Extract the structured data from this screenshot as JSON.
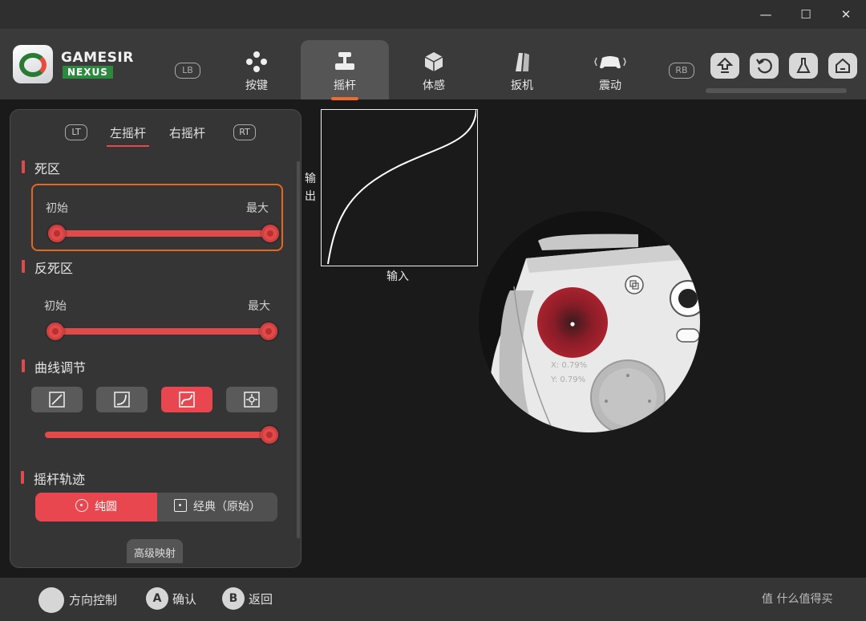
{
  "window": {
    "min": "—",
    "max": "☐",
    "close": "✕"
  },
  "brand": {
    "name": "GAMESIR",
    "sub": "NEXUS"
  },
  "bumpers": {
    "left": "LB",
    "right": "RB"
  },
  "tabs": [
    {
      "label": "按键",
      "icon": "gamepad-buttons-icon"
    },
    {
      "label": "摇杆",
      "icon": "joystick-icon"
    },
    {
      "label": "体感",
      "icon": "gyro-cube-icon"
    },
    {
      "label": "扳机",
      "icon": "trigger-icon"
    },
    {
      "label": "震动",
      "icon": "vibration-icon"
    }
  ],
  "active_tab": "摇杆",
  "right_actions": [
    "upload-icon",
    "reset-icon",
    "lab-flask-icon",
    "home-icon"
  ],
  "panel": {
    "trigger_left": "LT",
    "trigger_right": "RT",
    "subtabs": [
      "左摇杆",
      "右摇杆"
    ],
    "active_subtab": "左摇杆",
    "deadzone": {
      "title": "死区",
      "min_label": "初始",
      "max_label": "最大",
      "low": 0.0,
      "high": 1.0
    },
    "anti_deadzone": {
      "title": "反死区",
      "min_label": "初始",
      "max_label": "最大",
      "low": 0.0,
      "high": 1.0
    },
    "curve": {
      "title": "曲线调节",
      "presets": [
        "linear-curve-icon",
        "concave-curve-icon",
        "s-curve-icon",
        "custom-points-icon"
      ],
      "active_index": 2,
      "value": 1.0
    },
    "trace": {
      "title": "摇杆轨迹",
      "options": [
        "纯圆",
        "经典（原始）"
      ],
      "active_index": 0
    },
    "advanced": "高级映射"
  },
  "graph": {
    "ylabel": "输出",
    "xlabel": "输入"
  },
  "readout": {
    "x": "X:  0.79%",
    "y": "Y:  0.79%"
  },
  "bottom": [
    {
      "key": "",
      "label": "方向控制"
    },
    {
      "key": "A",
      "label": "确认"
    },
    {
      "key": "B",
      "label": "返回"
    }
  ],
  "watermark": "值 什么值得买"
}
